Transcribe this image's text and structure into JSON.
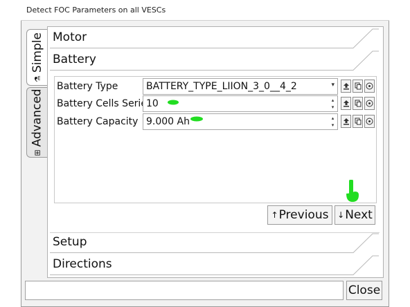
{
  "window": {
    "title": "Detect FOC Parameters on all VESCs"
  },
  "tabs": [
    {
      "label": "Simple",
      "icon": "magic-wand-icon",
      "selected": true
    },
    {
      "label": "Advanced",
      "icon": "grid-icon",
      "selected": false
    }
  ],
  "sections": {
    "motor": "Motor",
    "battery": "Battery",
    "setup": "Setup",
    "directions": "Directions"
  },
  "battery_params": [
    {
      "label": "Battery Type",
      "value": "BATTERY_TYPE_LIION_3_0__4_2",
      "control": "combo"
    },
    {
      "label": "Battery Cells Series",
      "value": "10",
      "control": "spinbox"
    },
    {
      "label": "Battery Capacity",
      "value": "9.000 Ah",
      "control": "spinbox"
    }
  ],
  "buttons": {
    "previous": "Previous",
    "next": "Next",
    "close": "Close"
  },
  "icons": {
    "previous_arrow": "↑",
    "next_arrow": "↓",
    "combo_arrow": "▾",
    "spin_up": "▴",
    "spin_down": "▾"
  },
  "status": {
    "value": ""
  },
  "colors": {
    "annotation": "#22dd22"
  }
}
